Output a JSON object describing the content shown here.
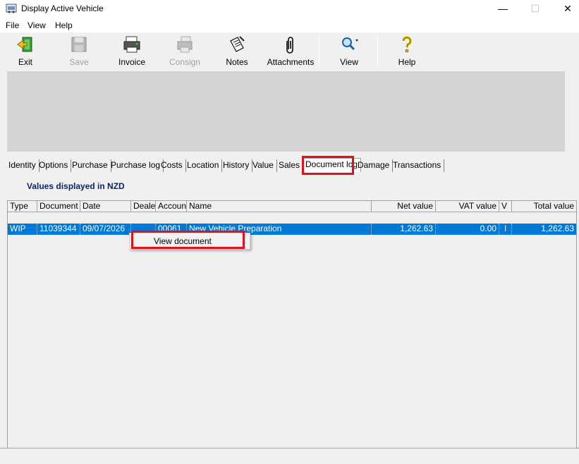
{
  "window": {
    "title": "Display Active Vehicle",
    "minimize": "—",
    "maximize": "☐",
    "close": "✕"
  },
  "menu": [
    "File",
    "View",
    "Help"
  ],
  "toolbar": {
    "exit": "Exit",
    "save": "Save",
    "invoice": "Invoice",
    "consign": "Consign",
    "notes": "Notes",
    "attachments": "Attachments",
    "view": "View",
    "help": "Help"
  },
  "tabs": [
    "Identity",
    "Options",
    "Purchase",
    "Purchase log",
    "Costs",
    "Location",
    "History",
    "Value",
    "Sales",
    "Document log",
    "Damage",
    "Transactions"
  ],
  "active_tab": "Document log",
  "values_note": "Values displayed in NZD",
  "grid": {
    "columns": [
      "Type",
      "Document",
      "Date",
      "Dealer",
      "Account",
      "Name",
      "Net value",
      "VAT value",
      "V",
      "Total value"
    ],
    "rows": [
      {
        "type": "WIP",
        "document": "11039344",
        "date": "09/07/2026",
        "dealer": "",
        "account": "00061",
        "name": "New Vehicle Preparation",
        "net_value": "1,262.63",
        "vat_value": "0.00",
        "v": "I",
        "total_value": "1,262.63"
      }
    ]
  },
  "context_menu": {
    "item": "View document"
  },
  "colors": {
    "selection": "#0078d7",
    "highlight": "#e0131d",
    "note": "#0a246a"
  }
}
